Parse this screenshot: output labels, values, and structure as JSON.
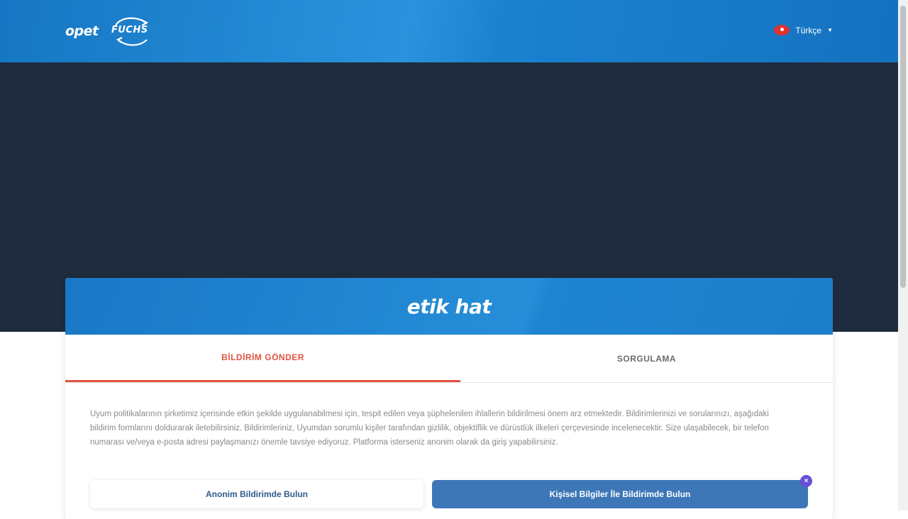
{
  "header": {
    "logo_opet": "opet",
    "logo_fuchs": "FUCHS",
    "language": {
      "label": "Türkçe",
      "flag": "turkey-flag-icon"
    }
  },
  "card": {
    "brand": "etik hat",
    "tabs": [
      {
        "label": "BİLDİRİM GÖNDER",
        "active": true
      },
      {
        "label": "SORGULAMA",
        "active": false
      }
    ],
    "description": "Uyum politikalarının şirketimiz içerisinde etkin şekilde uygulanabilmesi için, tespit edilen veya şüphelenilen ihlallerin bildirilmesi önem arz etmektedir. Bildirimlerinizi ve sorularınızı, aşağıdaki bildirim formlarını doldurarak iletebilirsiniz. Bildirimleriniz, Uyumdan sorumlu kişiler tarafından gizlilik, objektiflik ve dürüstlük ilkeleri çerçevesinde incelenecektir. Size ulaşabilecek, bir telefon numarası ve/veya e-posta adresi paylaşmanızı önemle tavsiye ediyoruz. Platforma isterseniz anonim olarak da giriş yapabilirsiniz.",
    "buttons": {
      "anonymous": "Anonim Bildirimde Bulun",
      "personal": "Kişisel Bilgiler İle Bildirimde Bulun"
    },
    "badge": "×"
  },
  "colors": {
    "header_blue": "#1b82cf",
    "hero_dark": "#1f2c3e",
    "active_tab": "#e0533f",
    "button_blue": "#3d77b7"
  }
}
